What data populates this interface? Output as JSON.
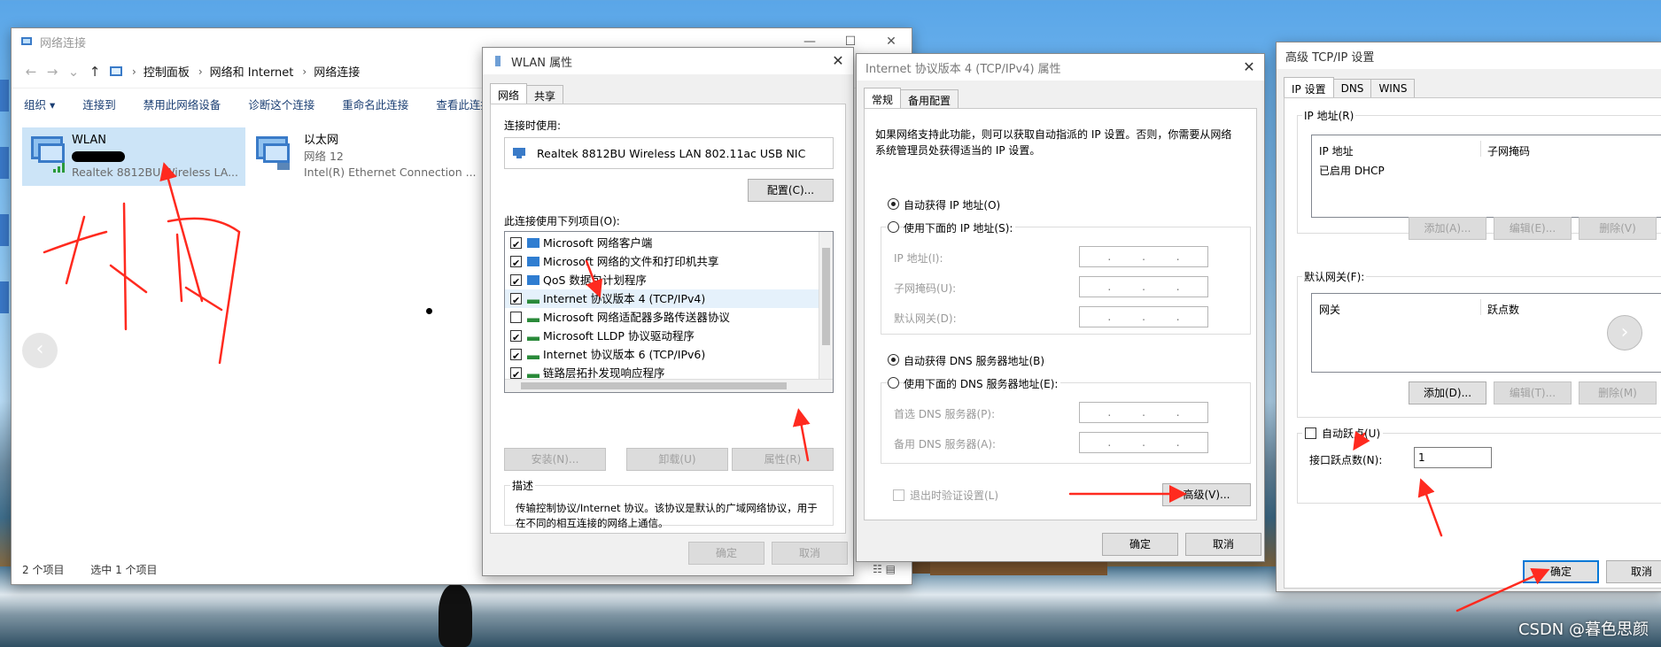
{
  "network_window": {
    "title": "网络连接",
    "breadcrumb": [
      "控制面板",
      "网络和 Internet",
      "网络连接"
    ],
    "commands": [
      "组织 ▾",
      "连接到",
      "禁用此网络设备",
      "诊断这个连接",
      "重命名此连接",
      "查看此连接"
    ],
    "items": [
      {
        "name": "WLAN",
        "sub": "",
        "device": "Realtek 8812BU Wireless LA..."
      },
      {
        "name": "以太网",
        "sub": "网络 12",
        "device": "Intel(R) Ethernet Connection ..."
      }
    ],
    "status": {
      "count": "2 个项目",
      "selected": "选中 1 个项目"
    }
  },
  "wlan_dialog": {
    "title": "WLAN 属性",
    "tabs": [
      "网络",
      "共享"
    ],
    "connect_using_label": "连接时使用:",
    "adapter": "Realtek 8812BU Wireless LAN 802.11ac USB NIC",
    "configure_button": "配置(C)...",
    "items_label": "此连接使用下列项目(O):",
    "components": [
      {
        "label": "Microsoft 网络客户端",
        "checked": true,
        "icon": "network-client-icon"
      },
      {
        "label": "Microsoft 网络的文件和打印机共享",
        "checked": true,
        "icon": "file-share-icon"
      },
      {
        "label": "QoS 数据包计划程序",
        "checked": true,
        "icon": "qos-icon"
      },
      {
        "label": "Internet 协议版本 4 (TCP/IPv4)",
        "checked": true,
        "icon": "protocol-icon"
      },
      {
        "label": "Microsoft 网络适配器多路传送器协议",
        "checked": false,
        "icon": "protocol-icon"
      },
      {
        "label": "Microsoft LLDP 协议驱动程序",
        "checked": true,
        "icon": "protocol-icon"
      },
      {
        "label": "Internet 协议版本 6 (TCP/IPv6)",
        "checked": true,
        "icon": "protocol-icon"
      },
      {
        "label": "链路层拓扑发现响应程序",
        "checked": true,
        "icon": "protocol-icon"
      }
    ],
    "install_button": "安装(N)...",
    "uninstall_button": "卸载(U)",
    "properties_button": "属性(R)",
    "description_label": "描述",
    "description_text": "传输控制协议/Internet 协议。该协议是默认的广域网络协议，用于在不同的相互连接的网络上通信。",
    "ok_button": "确定",
    "cancel_button": "取消"
  },
  "ipv4_dialog": {
    "title": "Internet 协议版本 4 (TCP/IPv4) 属性",
    "tabs": [
      "常规",
      "备用配置"
    ],
    "intro": "如果网络支持此功能，则可以获取自动指派的 IP 设置。否则，你需要从网络系统管理员处获得适当的 IP 设置。",
    "auto_ip": "自动获得 IP 地址(O)",
    "manual_ip": "使用下面的 IP 地址(S):",
    "ip_address": "IP 地址(I):",
    "subnet_mask": "子网掩码(U):",
    "default_gateway": "默认网关(D):",
    "auto_dns": "自动获得 DNS 服务器地址(B)",
    "manual_dns": "使用下面的 DNS 服务器地址(E):",
    "preferred_dns": "首选 DNS 服务器(P):",
    "alternate_dns": "备用 DNS 服务器(A):",
    "validate_on_exit": "退出时验证设置(L)",
    "advanced_button": "高级(V)...",
    "ok_button": "确定",
    "cancel_button": "取消"
  },
  "adv_dialog": {
    "title": "高级 TCP/IP 设置",
    "tabs": [
      "IP 设置",
      "DNS",
      "WINS"
    ],
    "ip_section": "IP 地址(R)",
    "ip_col": "IP 地址",
    "mask_col": "子网掩码",
    "ip_row": "已启用 DHCP",
    "add1": "添加(A)...",
    "edit1": "编辑(E)...",
    "del1": "删除(V)",
    "gw_section": "默认网关(F):",
    "gw_col": "网关",
    "metric_col": "跃点数",
    "add2": "添加(D)...",
    "edit2": "编辑(T)...",
    "del2": "删除(M)",
    "auto_metric": "自动跃点(U)",
    "iface_metric_label": "接口跃点数(N):",
    "iface_metric_value": "1",
    "ok_button": "确定",
    "cancel_button": "取消"
  },
  "watermark": "CSDN @暮色思颜",
  "annotation_color": "#ff2a1f"
}
